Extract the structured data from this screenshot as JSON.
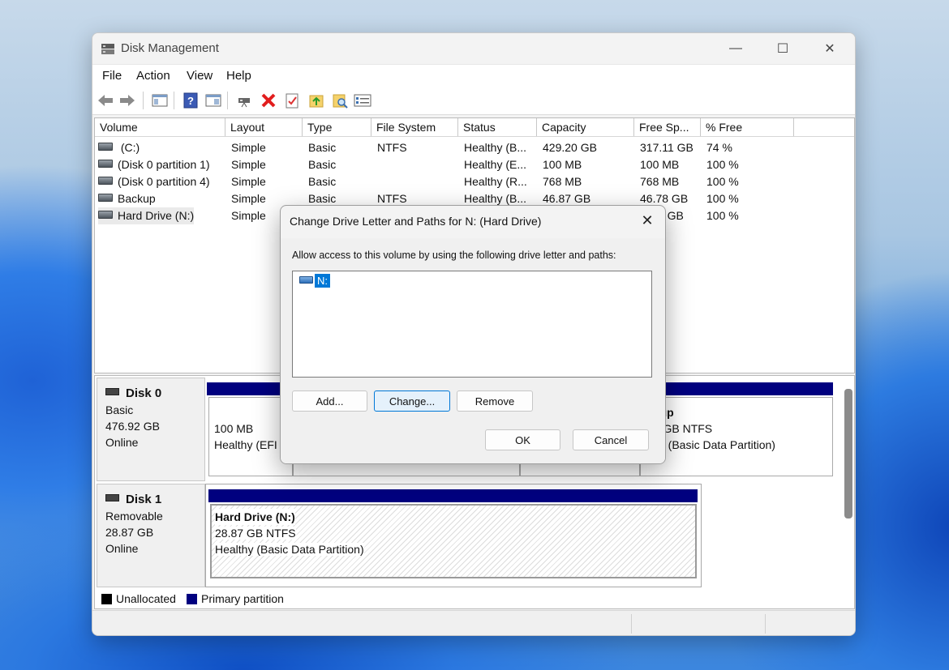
{
  "window": {
    "title": "Disk Management",
    "controls": {
      "minimize": "—",
      "maximize": "☐",
      "close": "✕"
    }
  },
  "menu": [
    "File",
    "Action",
    "View",
    "Help"
  ],
  "toolbar": {
    "icons": [
      "back-arrow-icon",
      "forward-arrow-icon",
      "console-tree-icon",
      "help-icon",
      "properties-view-icon",
      "connect-disk-icon",
      "delete-icon",
      "check-icon",
      "folder-up-icon",
      "search-folder-icon",
      "settings-list-icon"
    ],
    "delete_color": "#e21d1d"
  },
  "volumes": {
    "columns": [
      "Volume",
      "Layout",
      "Type",
      "File System",
      "Status",
      "Capacity",
      "Free Sp...",
      "% Free"
    ],
    "rows": [
      {
        "volume": "(C:)",
        "layout": "Simple",
        "type": "Basic",
        "fs": "NTFS",
        "status": "Healthy (B...",
        "capacity": "429.20 GB",
        "free": "317.11 GB",
        "pct": "74 %"
      },
      {
        "volume": "(Disk 0 partition 1)",
        "layout": "Simple",
        "type": "Basic",
        "fs": "",
        "status": "Healthy (E...",
        "capacity": "100 MB",
        "free": "100 MB",
        "pct": "100 %"
      },
      {
        "volume": "(Disk 0 partition 4)",
        "layout": "Simple",
        "type": "Basic",
        "fs": "",
        "status": "Healthy (R...",
        "capacity": "768 MB",
        "free": "768 MB",
        "pct": "100 %"
      },
      {
        "volume": "Backup",
        "layout": "Simple",
        "type": "Basic",
        "fs": "NTFS",
        "status": "Healthy (B...",
        "capacity": "46.87 GB",
        "free": "46.78 GB",
        "pct": "100 %"
      },
      {
        "volume": "Hard Drive (N:)",
        "layout": "Simple",
        "type": "",
        "fs": "",
        "status": "",
        "capacity": "",
        "free": ".0 GB",
        "pct": "100 %"
      }
    ]
  },
  "disks": [
    {
      "name": "Disk 0",
      "kind": "Basic",
      "size": "476.92 GB",
      "state": "Online",
      "partitions": [
        {
          "size": "100 MB",
          "status": "Healthy (EFI"
        },
        {
          "name": "ckup",
          "fs": "87 GB NTFS",
          "status": "lthy (Basic Data Partition)"
        }
      ]
    },
    {
      "name": "Disk 1",
      "kind": "Removable",
      "size": "28.87 GB",
      "state": "Online",
      "partitions": [
        {
          "name": "Hard Drive  (N:)",
          "fs": "28.87 GB NTFS",
          "status": "Healthy (Basic Data Partition)"
        }
      ]
    }
  ],
  "legend": {
    "unallocated": "Unallocated",
    "primary": "Primary partition",
    "unallocated_color": "#000000",
    "primary_color": "#00007f"
  },
  "dialog": {
    "title": "Change Drive Letter and Paths for N: (Hard Drive)",
    "close": "✕",
    "description": "Allow access to this volume by using the following drive letter and paths:",
    "path_item": "N:",
    "buttons": {
      "add": "Add...",
      "change": "Change...",
      "remove": "Remove",
      "ok": "OK",
      "cancel": "Cancel"
    }
  }
}
